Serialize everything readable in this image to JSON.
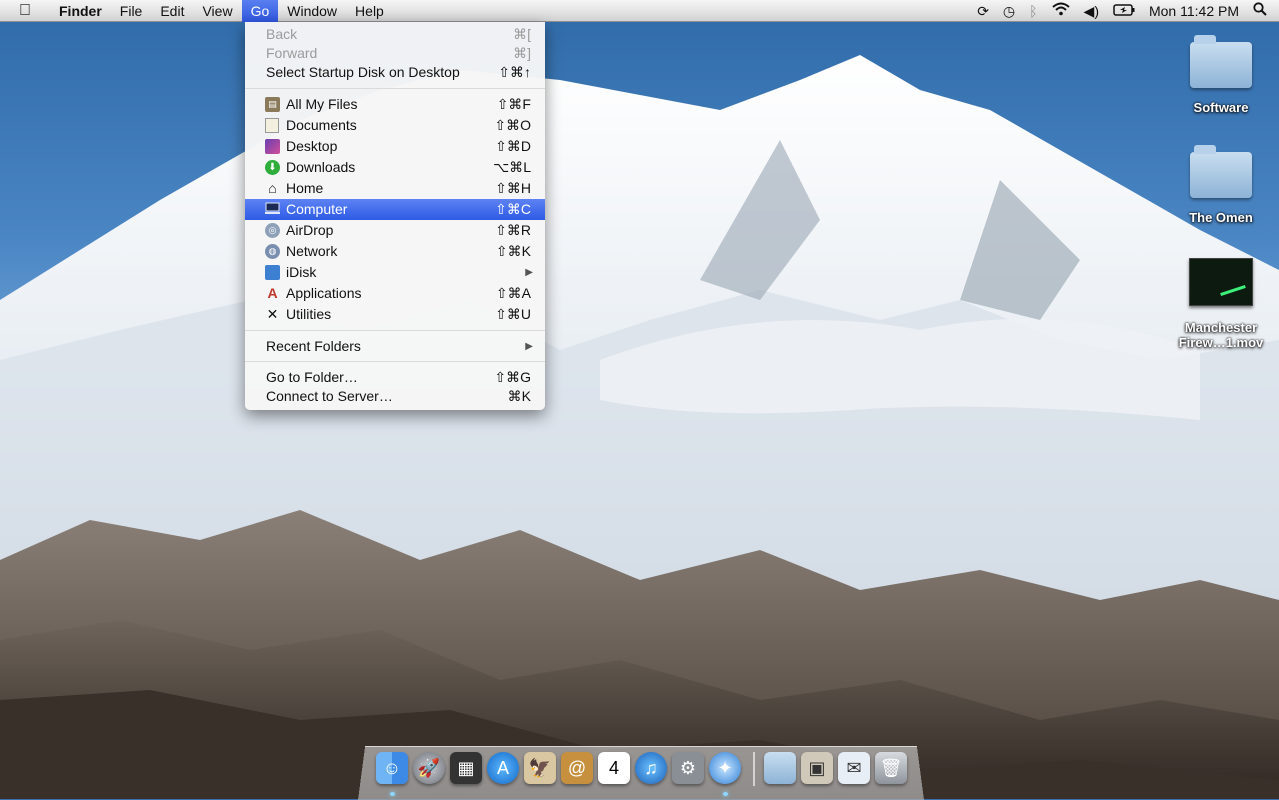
{
  "menubar": {
    "apple": "",
    "items": [
      "Finder",
      "File",
      "Edit",
      "View",
      "Go",
      "Window",
      "Help"
    ],
    "clock": "Mon 11:42 PM",
    "status_icons": [
      "sync-icon",
      "time-machine-icon",
      "bluetooth-icon",
      "wifi-icon",
      "volume-icon",
      "battery-icon",
      "spotlight-icon"
    ]
  },
  "go_menu": {
    "back": {
      "label": "Back",
      "shortcut": "⌘["
    },
    "forward": {
      "label": "Forward",
      "shortcut": "⌘]"
    },
    "startup": {
      "label": "Select Startup Disk on Desktop",
      "shortcut": "⇧⌘↑"
    },
    "all_files": {
      "label": "All My Files",
      "shortcut": "⇧⌘F"
    },
    "documents": {
      "label": "Documents",
      "shortcut": "⇧⌘O"
    },
    "desktop": {
      "label": "Desktop",
      "shortcut": "⇧⌘D"
    },
    "downloads": {
      "label": "Downloads",
      "shortcut": "⌥⌘L"
    },
    "home": {
      "label": "Home",
      "shortcut": "⇧⌘H"
    },
    "computer": {
      "label": "Computer",
      "shortcut": "⇧⌘C"
    },
    "airdrop": {
      "label": "AirDrop",
      "shortcut": "⇧⌘R"
    },
    "network": {
      "label": "Network",
      "shortcut": "⇧⌘K"
    },
    "idisk": {
      "label": "iDisk",
      "shortcut": ""
    },
    "applications": {
      "label": "Applications",
      "shortcut": "⇧⌘A"
    },
    "utilities": {
      "label": "Utilities",
      "shortcut": "⇧⌘U"
    },
    "recent": {
      "label": "Recent Folders",
      "shortcut": ""
    },
    "goto": {
      "label": "Go to Folder…",
      "shortcut": "⇧⌘G"
    },
    "connect": {
      "label": "Connect to Server…",
      "shortcut": "⌘K"
    }
  },
  "desktop_icons": {
    "software": "Software",
    "omen": "The Omen",
    "movie_line1": "Manchester",
    "movie_line2": "Firew…1.mov"
  },
  "colors": {
    "highlight": "#3a63e8",
    "menubar": "#e3e3e3"
  }
}
